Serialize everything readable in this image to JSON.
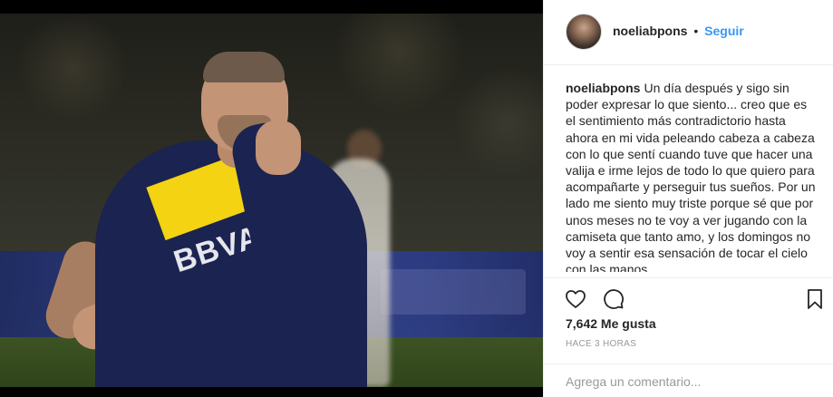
{
  "post": {
    "username": "noeliabpons",
    "separator": "•",
    "follow_label": "Seguir",
    "caption_user": "noeliabpons",
    "caption_text": "Un día después y sigo sin poder expresar lo que siento... creo que es el sentimiento más contradictorio hasta ahora en mi vida peleando cabeza a cabeza con lo que sentí cuando tuve que hacer una valija e irme lejos de todo lo que quiero para acompañarte y perseguir tus sueños. Por un lado me siento muy triste porque sé que por unos meses no te voy a ver jugando con la camiseta que tanto amo, y los domingos no voy a sentir esa sensación de tocar el cielo con las manos",
    "likes": "7,642 Me gusta",
    "time": "HACE 3 HORAS",
    "comment_placeholder": "Agrega un comentario...",
    "photo_sponsor_text": "BBVA"
  },
  "icons": {
    "like": "heart-outline-icon",
    "comment": "speech-bubble-icon",
    "save": "bookmark-outline-icon"
  },
  "colors": {
    "follow": "#3897f0",
    "text": "#262626",
    "muted": "#999999",
    "divider": "#efefef"
  }
}
